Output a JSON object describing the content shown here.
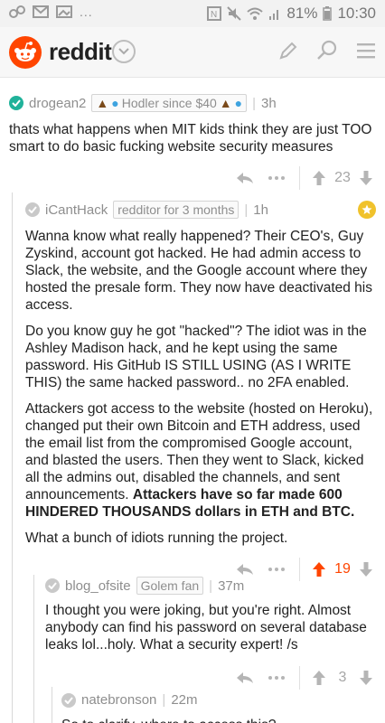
{
  "status_bar": {
    "dots": "...",
    "battery": "81%",
    "time": "10:30"
  },
  "app": {
    "brand": "reddit"
  },
  "comments": [
    {
      "author": "drogean2",
      "flair_text": "Hodler since $40",
      "age": "3h",
      "body": "thats what happens when MIT kids think they are just TOO smart to do basic fucking website security measures",
      "score": "23"
    },
    {
      "author": "iCantHack",
      "flair_text": "redditor for 3 months",
      "age": "1h",
      "paragraphs": [
        "Wanna know what really happened? Their CEO's, Guy Zyskind, account got hacked. He had admin access to Slack, the website, and the Google account where they hosted the presale form. They now have deactivated his access.",
        "Do you know guy he got \"hacked\"? The idiot was in the Ashley Madison hack, and he kept using the same password. His GitHub IS STILL USING (AS I WRITE THIS) the same hacked password.. no 2FA enabled.",
        "Attackers got access to the website (hosted on Heroku), changed put their own Bitcoin and ETH address, used the email list from the compromised Google account, and blasted the users. Then they went to Slack, kicked all the admins out, disabled the channels, and sent announcements.",
        "Attackers have so far made 600 HINDERED THOUSANDS dollars in ETH and BTC.",
        "What a bunch of idiots running the project."
      ],
      "score": "19"
    },
    {
      "author": "blog_ofsite",
      "flair_text": "Golem fan",
      "age": "37m",
      "body": "I thought you were joking, but you're right. Almost anybody can find his password on several database leaks lol...holy. What a security expert! /s",
      "score": "3"
    },
    {
      "author": "natebronson",
      "age": "22m",
      "body": "So to clarify, where to access this?"
    }
  ],
  "colors": {
    "brand_orange": "#ff4500",
    "upvoted": "#ff4500",
    "check_green": "#20b29a",
    "gold": "#f0c22c"
  },
  "icons": [
    "pencil-icon",
    "search-icon",
    "menu-icon",
    "reply-icon",
    "more-icon",
    "upvote-icon",
    "downvote-icon",
    "gold-star-icon"
  ]
}
